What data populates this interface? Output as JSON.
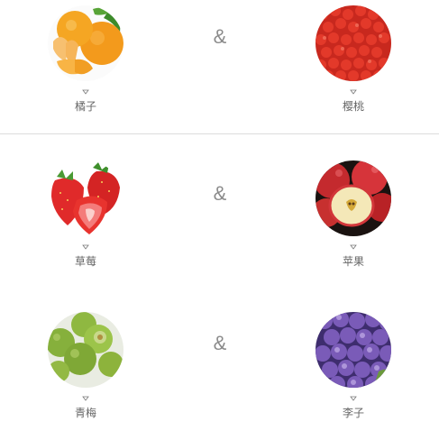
{
  "connector": "&",
  "rows": [
    {
      "left": {
        "name": "橘子",
        "icon": "orange-fruit-image"
      },
      "right": {
        "name": "樱桃",
        "icon": "cherry-fruit-image"
      }
    },
    {
      "left": {
        "name": "草莓",
        "icon": "strawberry-fruit-image"
      },
      "right": {
        "name": "苹果",
        "icon": "apple-fruit-image"
      }
    },
    {
      "left": {
        "name": "青梅",
        "icon": "green-plum-fruit-image"
      },
      "right": {
        "name": "李子",
        "icon": "plum-fruit-image"
      }
    }
  ],
  "colors": {
    "label": "#666666",
    "connector": "#8a8a8a",
    "divider": "#dcdcdc"
  }
}
